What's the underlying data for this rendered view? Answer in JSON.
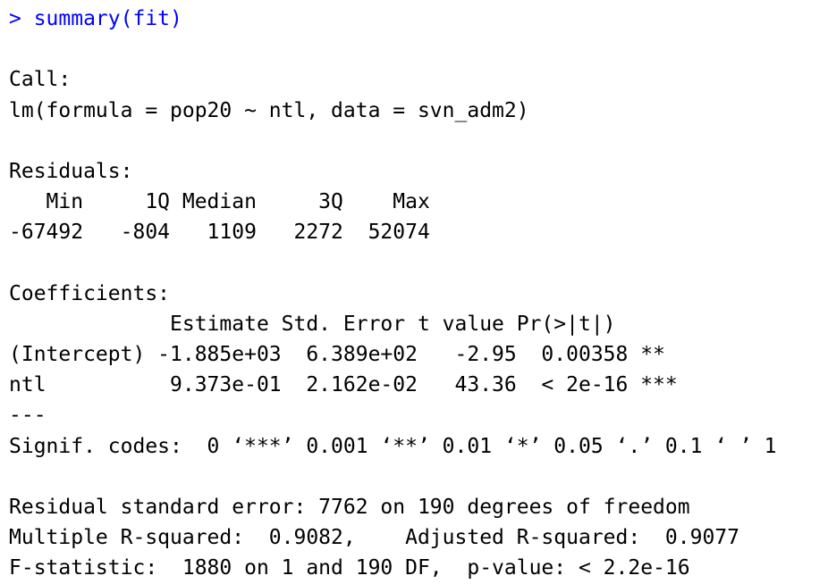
{
  "console": {
    "command": "> summary(fit)",
    "call_label": "Call:",
    "call": "lm(formula = pop20 ~ ntl, data = svn_adm2)",
    "residuals_label": "Residuals:",
    "residuals_header": "   Min     1Q Median     3Q    Max",
    "residuals_values": "-67492   -804   1109   2272  52074",
    "coefficients_label": "Coefficients:",
    "coef_header": "             Estimate Std. Error t value Pr(>|t|)",
    "coef_rows": [
      "(Intercept) -1.885e+03  6.389e+02   -2.95  0.00358 **",
      "ntl          9.373e-01  2.162e-02   43.36  < 2e-16 ***"
    ],
    "separator": "---",
    "signif_codes": "Signif. codes:  0 ‘***’ 0.001 ‘**’ 0.01 ‘*’ 0.05 ‘.’ 0.1 ‘ ’ 1",
    "residual_se": "Residual standard error: 7762 on 190 degrees of freedom",
    "r_squared": "Multiple R-squared:  0.9082,    Adjusted R-squared:  0.9077",
    "f_statistic": "F-statistic:  1880 on 1 and 190 DF,  p-value: < 2.2e-16"
  },
  "colors": {
    "command": "#0000ff",
    "output": "#000000",
    "background": "#ffffff"
  }
}
